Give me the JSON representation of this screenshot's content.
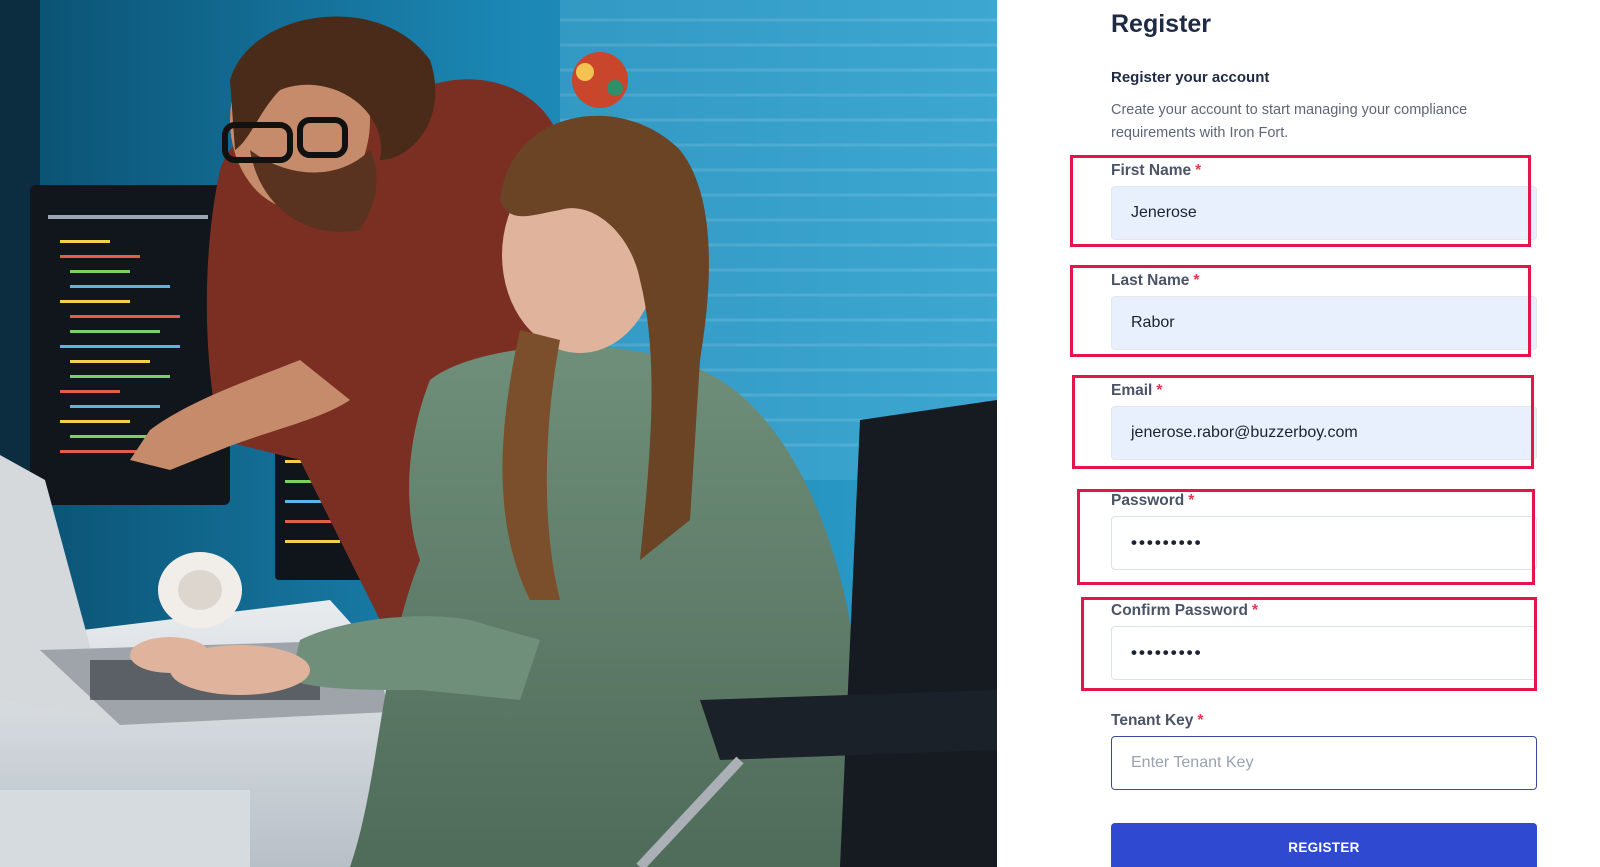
{
  "hero": {
    "image_alt": "photo-two-developers-at-computer"
  },
  "form": {
    "title": "Register",
    "subtitle": "Register your account",
    "description": "Create your account to start managing your compliance requirements with Iron Fort.",
    "required_marker": "*",
    "fields": {
      "first_name": {
        "label": "First Name",
        "value": "Jenerose"
      },
      "last_name": {
        "label": "Last Name",
        "value": "Rabor"
      },
      "email": {
        "label": "Email",
        "value": "jenerose.rabor@buzzerboy.com"
      },
      "password": {
        "label": "Password",
        "value": "•••••••••"
      },
      "confirm_password": {
        "label": "Confirm Password",
        "value": "•••••••••"
      },
      "tenant_key": {
        "label": "Tenant Key",
        "value": "",
        "placeholder": "Enter Tenant Key"
      }
    },
    "submit_label": "REGISTER"
  },
  "colors": {
    "highlight": "#e3154a",
    "button": "#3049d1",
    "filled_input": "#e9f0fd",
    "title": "#1f2a44"
  }
}
